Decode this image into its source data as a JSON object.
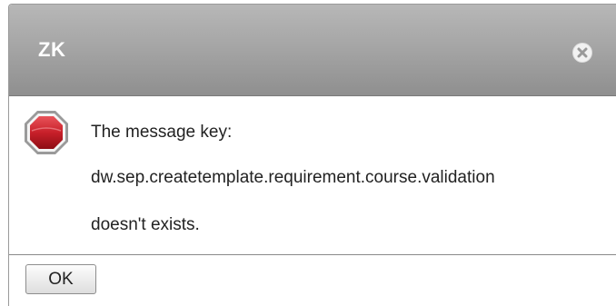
{
  "dialog": {
    "title": "ZK",
    "icon": "stop-icon",
    "message_lines": [
      "The message key:",
      "dw.sep.createtemplate.requirement.course.validation",
      "doesn't exists."
    ],
    "ok_label": "OK"
  },
  "colors": {
    "title_bar": "#a6a6a6",
    "title_text": "#ffffff",
    "stop_icon": "#c8202a"
  }
}
